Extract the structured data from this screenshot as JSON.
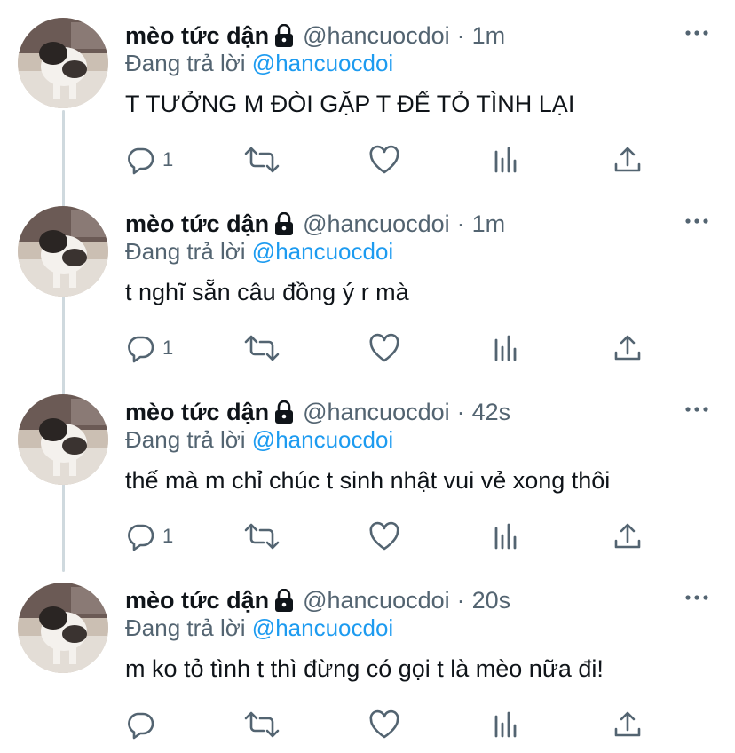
{
  "tweets": [
    {
      "name": "mèo tức dận",
      "handle": "@hancuocdoi",
      "time": "1m",
      "replying_prefix": "Đang trả lời",
      "replying_to": "@hancuocdoi",
      "text": "T TƯỞNG M ĐÒI GẶP T ĐỂ TỎ TÌNH LẠI",
      "reply_count": "1"
    },
    {
      "name": "mèo tức dận",
      "handle": "@hancuocdoi",
      "time": "1m",
      "replying_prefix": "Đang trả lời",
      "replying_to": "@hancuocdoi",
      "text": "t nghĩ sẵn câu đồng ý r mà",
      "reply_count": "1"
    },
    {
      "name": "mèo tức dận",
      "handle": "@hancuocdoi",
      "time": "42s",
      "replying_prefix": "Đang trả lời",
      "replying_to": "@hancuocdoi",
      "text": "thế mà m chỉ chúc t sinh nhật vui vẻ xong thôi",
      "reply_count": "1"
    },
    {
      "name": "mèo tức dận",
      "handle": "@hancuocdoi",
      "time": "20s",
      "replying_prefix": "Đang trả lời",
      "replying_to": "@hancuocdoi",
      "text": "m ko tỏ tình t thì đừng có gọi t là mèo nữa đi!",
      "reply_count": ""
    }
  ],
  "separator": "·",
  "colors": {
    "text": "#0f1419",
    "secondary": "#536471",
    "link": "#1d9bf0",
    "thread_line": "#cfd9de"
  },
  "icons": [
    "cat-avatar",
    "lock-icon",
    "more-icon",
    "reply-icon",
    "retweet-icon",
    "like-icon",
    "analytics-icon",
    "share-icon"
  ]
}
